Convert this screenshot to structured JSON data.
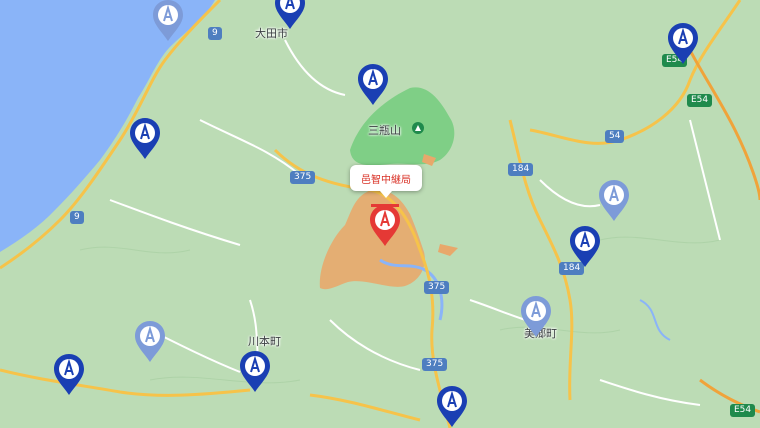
{
  "map": {
    "colors": {
      "sea": "#8ab4f8",
      "land": "#bcdcb5",
      "forest": "#7fcf86",
      "highlight": "#e8a86b",
      "road_major": "#f6c34a",
      "road_minor": "#ffffff",
      "pin_active": "#1a3fb3",
      "pin_faded": "#7d9bd8",
      "pin_selected": "#e53935"
    },
    "place_labels": {
      "ota": "大田市",
      "sanbe": "三瓶山",
      "kawamoto": "川本町",
      "misato": "美郷町"
    },
    "selected_label": "邑智中継局",
    "road_shields": {
      "r9_a": "9",
      "r9_b": "9",
      "r375_a": "375",
      "r375_b": "375",
      "r375_c": "375",
      "r184_a": "184",
      "r184_b": "184",
      "r54": "54",
      "e54_a": "E54",
      "e54_b": "E54",
      "e54_c": "E54"
    },
    "pins": [
      {
        "id": "pin-1",
        "style": "faded"
      },
      {
        "id": "pin-2",
        "style": "active"
      },
      {
        "id": "pin-3",
        "style": "active"
      },
      {
        "id": "pin-4",
        "style": "active"
      },
      {
        "id": "pin-5",
        "style": "active"
      },
      {
        "id": "pin-6",
        "style": "faded"
      },
      {
        "id": "pin-7",
        "style": "active"
      },
      {
        "id": "pin-8",
        "style": "faded"
      },
      {
        "id": "pin-9",
        "style": "faded"
      },
      {
        "id": "pin-10",
        "style": "active"
      },
      {
        "id": "pin-11",
        "style": "active"
      },
      {
        "id": "pin-12",
        "style": "active"
      },
      {
        "id": "pin-selected",
        "style": "selected"
      }
    ]
  }
}
